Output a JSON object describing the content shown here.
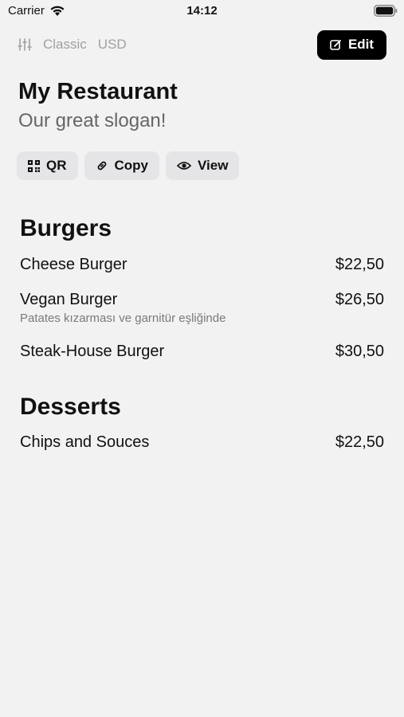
{
  "status_bar": {
    "carrier": "Carrier",
    "time": "14:12"
  },
  "toolbar": {
    "theme": "Classic",
    "currency": "USD",
    "edit_label": "Edit"
  },
  "restaurant": {
    "name": "My Restaurant",
    "slogan": "Our great slogan!"
  },
  "actions": {
    "qr_label": "QR",
    "copy_label": "Copy",
    "view_label": "View"
  },
  "menu": {
    "categories": [
      {
        "title": "Burgers",
        "items": [
          {
            "name": "Cheese Burger",
            "price": "$22,50"
          },
          {
            "name": "Vegan Burger",
            "price": "$26,50",
            "description": "Patates kızarması ve garnitür eşliğinde"
          },
          {
            "name": "Steak-House Burger",
            "price": "$30,50"
          }
        ]
      },
      {
        "title": "Desserts",
        "items": [
          {
            "name": "Chips and Souces",
            "price": "$22,50"
          }
        ]
      }
    ]
  }
}
